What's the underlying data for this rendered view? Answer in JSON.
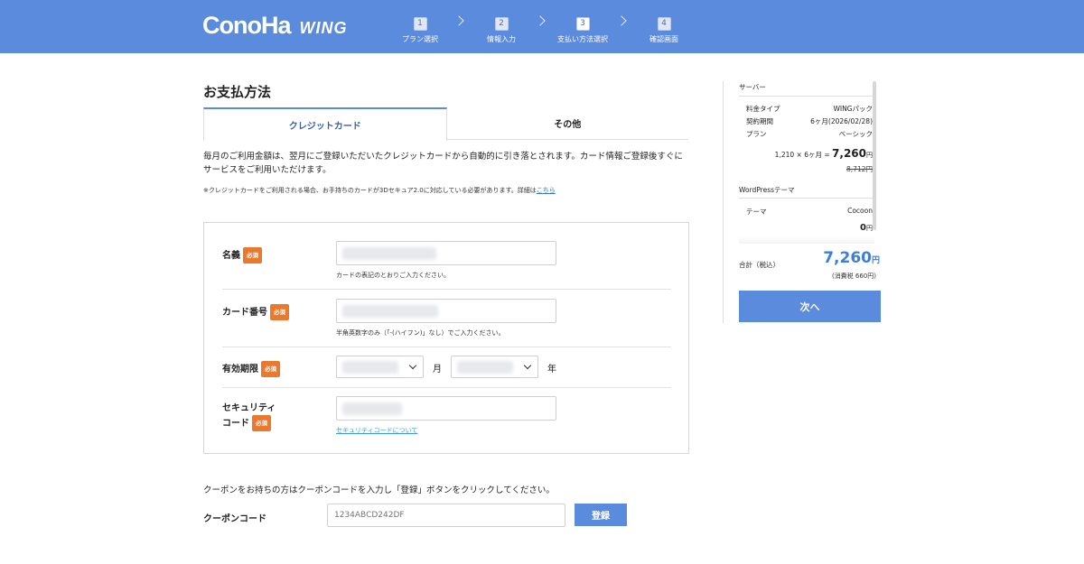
{
  "header": {
    "logo_main": "ConoHa",
    "logo_sub": "WING",
    "steps": [
      {
        "num": "1",
        "label": "プラン選択"
      },
      {
        "num": "2",
        "label": "情報入力"
      },
      {
        "num": "3",
        "label": "支払い方法選択"
      },
      {
        "num": "4",
        "label": "確認画面"
      }
    ],
    "active_step": 3
  },
  "main": {
    "title": "お支払方法",
    "tabs": [
      {
        "label": "クレジットカード"
      },
      {
        "label": "その他"
      }
    ],
    "description": "毎月のご利用金額は、翌月にご登録いただいたクレジットカードから自動的に引き落とされます。カード情報ご登録後すぐにサービスをご利用いただけます。",
    "note": "※クレジットカードをご利用される場合、お手持ちのカードが3Dセキュア2.0に対応している必要があります。詳細は",
    "note_link": "こちら",
    "required_badge": "必須",
    "form": {
      "name_label": "名義",
      "name_hint": "カードの表記のとおりご入力ください。",
      "card_number_label": "カード番号",
      "card_number_hint": "半角英数字のみ（「-(ハイフン)」なし）でご入力ください。",
      "expiry_label": "有効期限",
      "month_unit": "月",
      "year_unit": "年",
      "security_label_line1": "セキュリティ",
      "security_label_line2": "コード",
      "security_link": "セキュリティコードについて"
    },
    "coupon": {
      "instruction": "クーポンをお持ちの方はクーポンコードを入力し「登録」ボタンをクリックしてください。",
      "label": "クーポンコード",
      "placeholder": "1234ABCD242DF",
      "button": "登録"
    }
  },
  "sidebar": {
    "server_heading": "サーバー",
    "server_rows": [
      {
        "key": "料金タイプ",
        "value": "WINGパック"
      },
      {
        "key": "契約期間",
        "value": "6ヶ月(2026/02/28)"
      },
      {
        "key": "プラン",
        "value": "ベーシック"
      }
    ],
    "calc_prefix": "1,210 × 6ヶ月 = ",
    "calc_total": "7,260",
    "calc_yen": "円",
    "original_price": "8,712円",
    "wp_heading": "WordPressテーマ",
    "theme_key": "テーマ",
    "theme_value": "Cocoon",
    "theme_price": "0",
    "theme_yen": "円",
    "total_label": "合計（税込）",
    "total_value": "7,260",
    "total_yen": "円",
    "tax_note": "(消費税 660円)",
    "next_button": "次へ"
  },
  "colors": {
    "brand": "#5b8bdc",
    "required": "#e8792e",
    "total": "#3d7fd6"
  }
}
